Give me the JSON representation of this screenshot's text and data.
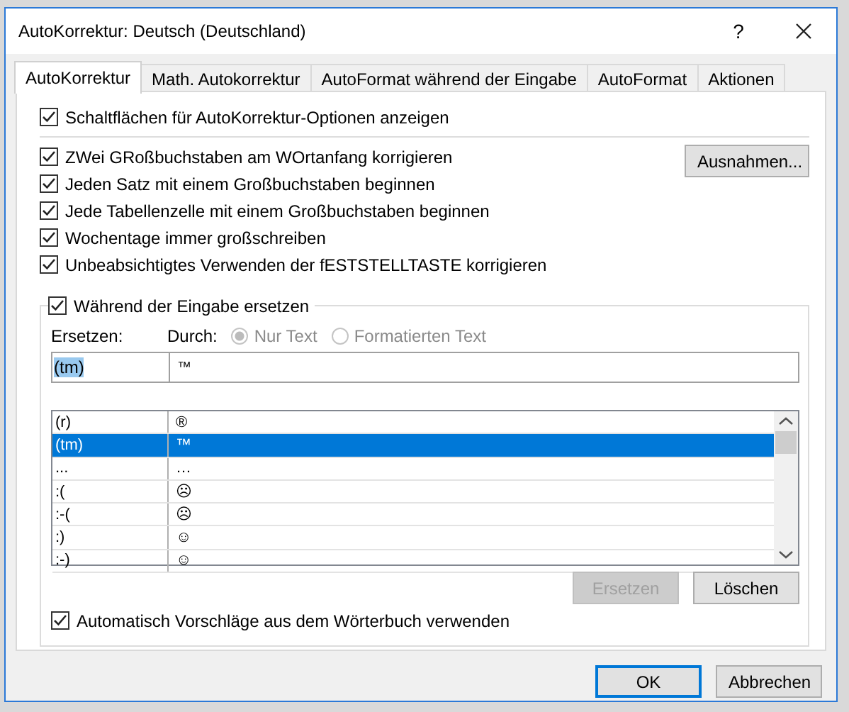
{
  "window": {
    "title": "AutoKorrektur: Deutsch (Deutschland)",
    "help": "?"
  },
  "tabs": [
    {
      "label": "AutoKorrektur",
      "selected": true
    },
    {
      "label": "Math. Autokorrektur",
      "selected": false
    },
    {
      "label": "AutoFormat während der Eingabe",
      "selected": false
    },
    {
      "label": "AutoFormat",
      "selected": false
    },
    {
      "label": "Aktionen",
      "selected": false
    }
  ],
  "show_buttons_option": {
    "label": "Schaltflächen für AutoKorrektur-Optionen anzeigen",
    "checked": true
  },
  "options": [
    {
      "label": "ZWei GRoßbuchstaben am WOrtanfang korrigieren",
      "checked": true
    },
    {
      "label": "Jeden Satz mit einem Großbuchstaben beginnen",
      "checked": true
    },
    {
      "label": "Jede Tabellenzelle mit einem Großbuchstaben beginnen",
      "checked": true
    },
    {
      "label": "Wochentage immer großschreiben",
      "checked": true
    },
    {
      "label": "Unbeabsichtigtes Verwenden der fESTSTELLTASTE korrigieren",
      "checked": true
    }
  ],
  "exceptions_button": "Ausnahmen...",
  "replace_section": {
    "label": "Während der Eingabe ersetzen",
    "checked": true,
    "replace_label": "Ersetzen:",
    "with_label": "Durch:",
    "format_options": [
      {
        "label": "Nur Text",
        "selected": true,
        "disabled": true
      },
      {
        "label": "Formatierten Text",
        "selected": false,
        "disabled": true
      }
    ],
    "replace_value": "(tm)",
    "with_value": "™",
    "entries": [
      {
        "replace": "(r)",
        "with": "®",
        "selected": false
      },
      {
        "replace": "(tm)",
        "with": "™",
        "selected": true
      },
      {
        "replace": "...",
        "with": "…",
        "selected": false
      },
      {
        "replace": ":(",
        "with": "☹",
        "selected": false
      },
      {
        "replace": ":-(",
        "with": "☹",
        "selected": false
      },
      {
        "replace": ":)",
        "with": "☺",
        "selected": false
      },
      {
        "replace": ":-)",
        "with": "☺",
        "selected": false
      }
    ],
    "buttons": [
      {
        "label": "Ersetzen",
        "disabled": true
      },
      {
        "label": "Löschen",
        "disabled": false
      }
    ]
  },
  "dictionary_option": {
    "label": "Automatisch Vorschläge aus dem Wörterbuch verwenden",
    "checked": true
  },
  "footer_buttons": [
    {
      "label": "OK",
      "default": true
    },
    {
      "label": "Abbrechen",
      "default": false
    }
  ]
}
